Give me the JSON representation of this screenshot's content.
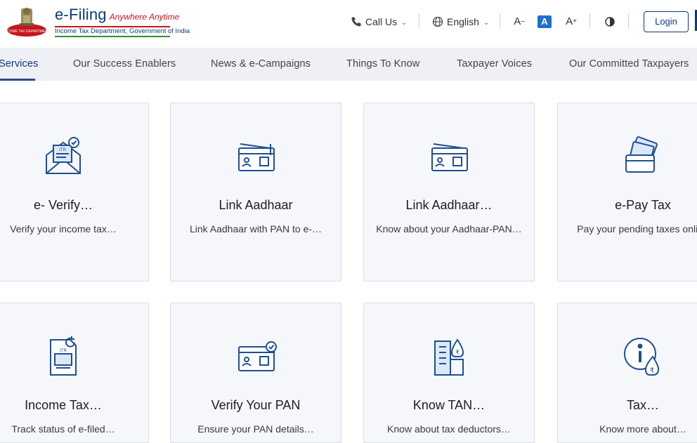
{
  "header": {
    "brand_title": "e-Filing",
    "brand_tagline": "Anywhere Anytime",
    "brand_subtitle": "Income Tax Department, Government of India",
    "call_us": "Call Us",
    "language": "English",
    "font_decrease": "A-",
    "font_normal": "A",
    "font_increase": "A+",
    "login": "Login"
  },
  "nav": {
    "items": [
      "Services",
      "Our Success Enablers",
      "News & e-Campaigns",
      "Things To Know",
      "Taxpayer Voices",
      "Our Committed Taxpayers"
    ]
  },
  "cards": [
    {
      "title": "e- Verify…",
      "desc": "Verify your income tax…",
      "icon": "itr-envelope-icon"
    },
    {
      "title": "Link Aadhaar",
      "desc": "Link Aadhaar with PAN to e-…",
      "icon": "aadhaar-card-icon"
    },
    {
      "title": "Link Aadhaar…",
      "desc": "Know about your Aadhaar-PAN…",
      "icon": "aadhaar-card-icon"
    },
    {
      "title": "e-Pay Tax",
      "desc": "Pay your pending taxes online",
      "icon": "wallet-cards-icon"
    },
    {
      "title": "Income Tax…",
      "desc": "Track status of e-filed…",
      "icon": "itr-refresh-icon"
    },
    {
      "title": "Verify Your PAN",
      "desc": "Ensure your PAN details…",
      "icon": "pan-verified-icon"
    },
    {
      "title": "Know TAN…",
      "desc": "Know about tax deductors…",
      "icon": "building-money-icon"
    },
    {
      "title": "Tax…",
      "desc": "Know more about…",
      "icon": "info-money-icon"
    }
  ],
  "colors": {
    "primary": "#0c3b78",
    "accent_red": "#c4161c",
    "icon_blue": "#1f4f93",
    "nav_bg": "#eef0f5",
    "card_bg": "#f6f7fb"
  }
}
